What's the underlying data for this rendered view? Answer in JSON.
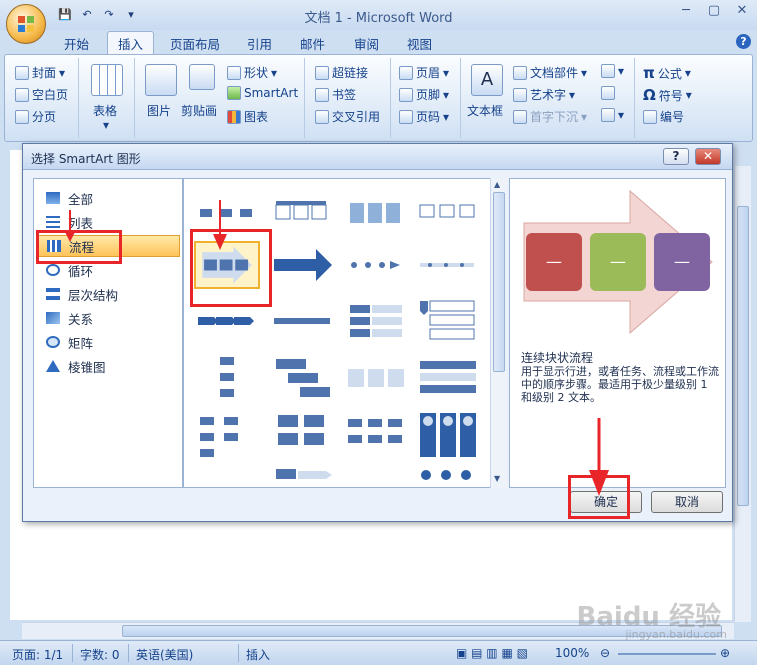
{
  "window": {
    "title": "文档 1 - Microsoft Word"
  },
  "tabs": [
    "开始",
    "插入",
    "页面布局",
    "引用",
    "邮件",
    "审阅",
    "视图"
  ],
  "active_tab": "插入",
  "ribbon": {
    "pages": [
      "封面",
      "空白页",
      "分页"
    ],
    "table": "表格",
    "illustrations": {
      "picture": "图片",
      "clipart": "剪贴画",
      "shapes": "形状",
      "smartart": "SmartArt",
      "chart": "图表"
    },
    "links": [
      "超链接",
      "书签",
      "交叉引用"
    ],
    "header_footer": [
      "页眉",
      "页脚",
      "页码"
    ],
    "text": {
      "textbox": "文本框",
      "parts": "文档部件",
      "wordart": "艺术字",
      "dropcap": "首字下沉"
    },
    "symbols": [
      "公式",
      "符号",
      "编号"
    ]
  },
  "dialog": {
    "title": "选择 SmartArt 图形",
    "help": "?",
    "close": "✕",
    "categories": [
      {
        "label": "全部",
        "icon": "all-icon"
      },
      {
        "label": "列表",
        "icon": "list-icon"
      },
      {
        "label": "流程",
        "icon": "process-icon"
      },
      {
        "label": "循环",
        "icon": "cycle-icon"
      },
      {
        "label": "层次结构",
        "icon": "hierarchy-icon"
      },
      {
        "label": "关系",
        "icon": "relationship-icon"
      },
      {
        "label": "矩阵",
        "icon": "matrix-icon"
      },
      {
        "label": "棱锥图",
        "icon": "pyramid-icon"
      }
    ],
    "selected_category": "流程",
    "preview": {
      "title": "连续块状流程",
      "description": "用于显示行进，或者任务、流程或工作流中的顺序步骤。最适用于极少量级别 1 和级别 2 文本。",
      "block_text": "—",
      "colors": {
        "arrow": "#f3d6d3",
        "block1": "#c0504d",
        "block2": "#9bbb59",
        "block3": "#8064a2"
      }
    },
    "ok": "确定",
    "cancel": "取消"
  },
  "status": {
    "page": "页面: 1/1",
    "words": "字数: 0",
    "lang": "英语(美国)",
    "mode": "插入",
    "zoom": "100%"
  },
  "watermark": {
    "brand": "Baidu 经验",
    "url": "jingyan.baidu.com"
  },
  "accent": {
    "red": "#e8262a",
    "gold": "#f0b030"
  }
}
